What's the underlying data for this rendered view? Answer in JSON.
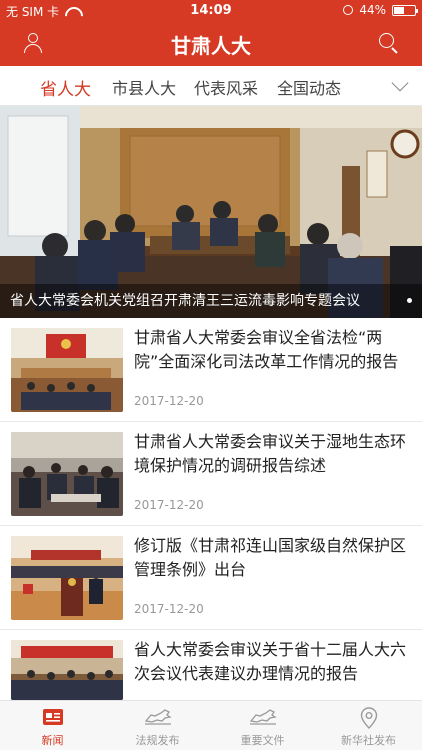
{
  "status_bar": {
    "carrier": "无 SIM 卡",
    "time": "14:09",
    "battery": "44%",
    "battery_level": 0.44
  },
  "nav": {
    "title": "甘肃人大",
    "left_icon": "user-icon",
    "right_icon": "search-icon"
  },
  "tabs": [
    {
      "label": "省人大",
      "active": true
    },
    {
      "label": "市县人大",
      "active": false
    },
    {
      "label": "代表风采",
      "active": false
    },
    {
      "label": "全国动态",
      "active": false
    }
  ],
  "hero": {
    "caption": "省人大常委会机关党组召开肃清王三运流毒影响专题会议"
  },
  "news": [
    {
      "title": "甘肃省人大常委会审议全省法检“两院”全面深化司法改革工作情况的报告",
      "date": "2017-12-20"
    },
    {
      "title": "甘肃省人大常委会审议关于湿地生态环境保护情况的调研报告综述",
      "date": "2017-12-20"
    },
    {
      "title": "修订版《甘肃祁连山国家级自然保护区管理条例》出台",
      "date": "2017-12-20"
    },
    {
      "title": "省人大常委会审议关于省十二届人大六次会议代表建议办理情况的报告",
      "date": ""
    }
  ],
  "tabbar": [
    {
      "label": "新闻",
      "icon": "newspaper-icon",
      "active": true
    },
    {
      "label": "法规发布",
      "icon": "horse-icon",
      "active": false
    },
    {
      "label": "重要文件",
      "icon": "horse-icon",
      "active": false
    },
    {
      "label": "新华社发布",
      "icon": "location-pin-icon",
      "active": false
    }
  ],
  "colors": {
    "brand": "#d63a24",
    "inactive": "#999999"
  }
}
